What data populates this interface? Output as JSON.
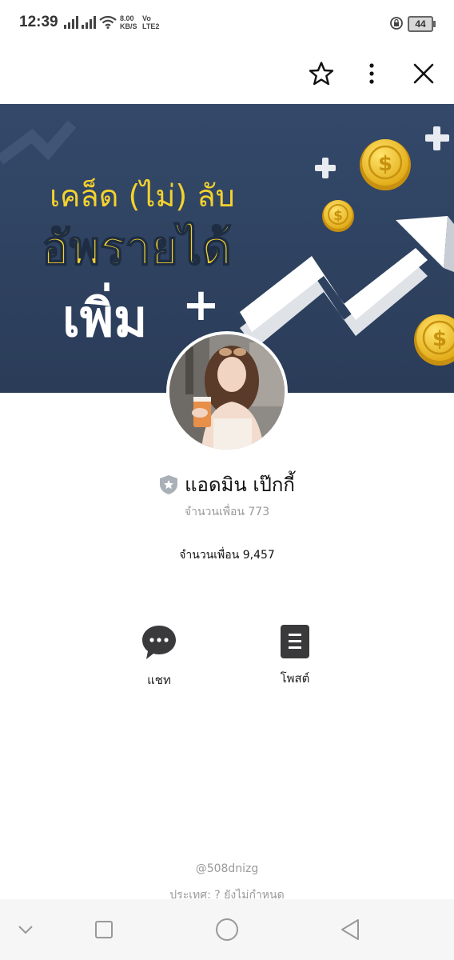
{
  "status_bar": {
    "time": "12:39",
    "net_speed": "8.00",
    "net_unit": "KB/S",
    "volte_line1": "Vo",
    "volte_line2": "LTE2",
    "battery": "44"
  },
  "toolbar": {
    "favorite_icon": "star-outline-icon",
    "more_icon": "vertical-dots-icon",
    "close_icon": "close-icon"
  },
  "cover": {
    "line1": "เคล็ด (ไม่) ลับ",
    "line2": "อัพรายได้",
    "line3": "เพิ่ม",
    "plus": "+",
    "coin_symbol": "$",
    "colors": {
      "background": "#2e4360",
      "accent": "#f3d22d",
      "text": "#ffffff"
    }
  },
  "profile": {
    "name": "แอดมิน เป๊กกี้",
    "badge_icon": "shield-star-icon",
    "friends_grey": "จำนวนเพื่อน 773",
    "friends_count": "จำนวนเพื่อน 9,457"
  },
  "actions": [
    {
      "label": "แชท",
      "icon": "chat-bubble-icon"
    },
    {
      "label": "โพสต์",
      "icon": "post-list-icon"
    }
  ],
  "footer": {
    "id": "@508dnizg",
    "type": "ประเทศ: ? ยังไม่กำหนด"
  },
  "nav_bar": {
    "items": [
      "chevron-down-icon",
      "recent-apps-icon",
      "home-icon",
      "back-icon"
    ]
  }
}
